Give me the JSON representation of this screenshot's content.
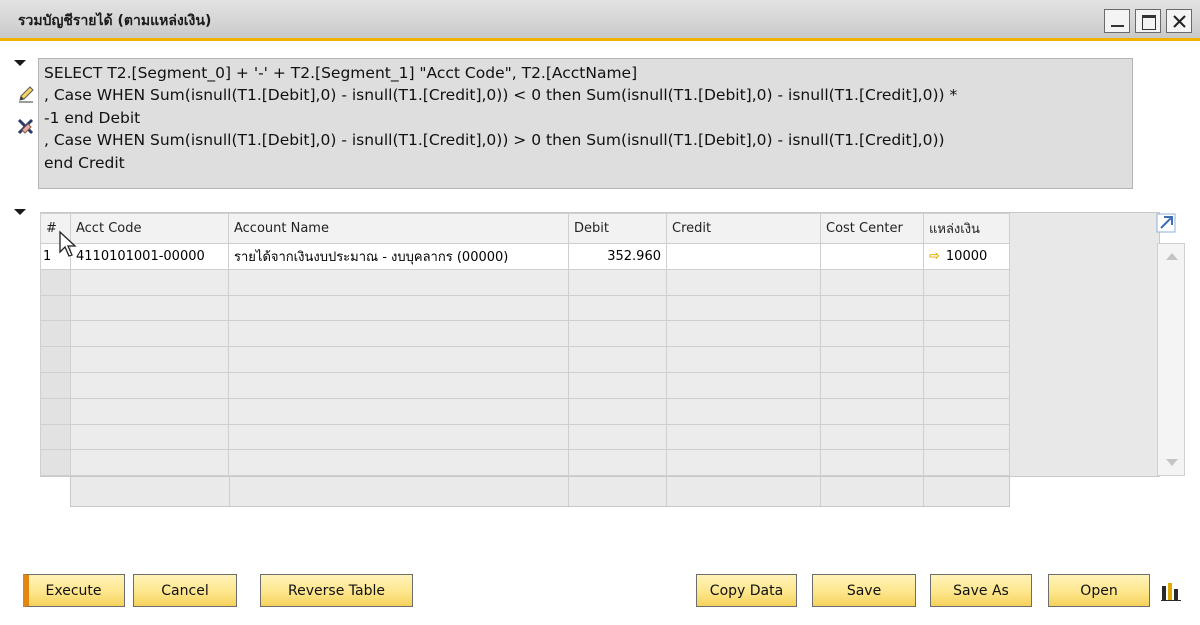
{
  "window": {
    "title": "รวมบัญชีรายได้ (ตามแหล่งเงิน)"
  },
  "query": {
    "text": "SELECT T2.[Segment_0] + '-' + T2.[Segment_1] \"Acct Code\", T2.[AcctName]\n, Case WHEN Sum(isnull(T1.[Debit],0) - isnull(T1.[Credit],0)) < 0 then Sum(isnull(T1.[Debit],0) - isnull(T1.[Credit],0)) *\n-1 end Debit\n, Case WHEN Sum(isnull(T1.[Debit],0) - isnull(T1.[Credit],0)) > 0 then Sum(isnull(T1.[Debit],0) - isnull(T1.[Credit],0))\nend Credit"
  },
  "grid": {
    "columns": {
      "num": "#",
      "acct_code": "Acct Code",
      "account_name": "Account Name",
      "debit": "Debit",
      "credit": "Credit",
      "cost_center": "Cost Center",
      "fund_source": "แหล่งเงิน"
    },
    "rows": [
      {
        "num": "1",
        "acct_code": "4110101001-00000",
        "account_name": "รายได้จากเงินงบประมาณ - งบบุคลากร (00000)",
        "debit": "352.960",
        "credit": "",
        "cost_center": "",
        "fund_source": "10000"
      }
    ]
  },
  "buttons": {
    "execute": "Execute",
    "cancel": "Cancel",
    "reverse_table": "Reverse Table",
    "copy_data": "Copy Data",
    "save": "Save",
    "save_as": "Save As",
    "open": "Open"
  },
  "colors": {
    "accent": "#f0b400",
    "button_fill": "#fde68c",
    "execute_marker": "#e2870f",
    "link_arrow": "#e8a800"
  },
  "icons": {
    "edit": "pencil-icon",
    "clear": "clear-query-icon",
    "expand": "expand-arrow-icon",
    "chart": "bar-chart-icon",
    "link": "link-arrow-icon"
  }
}
